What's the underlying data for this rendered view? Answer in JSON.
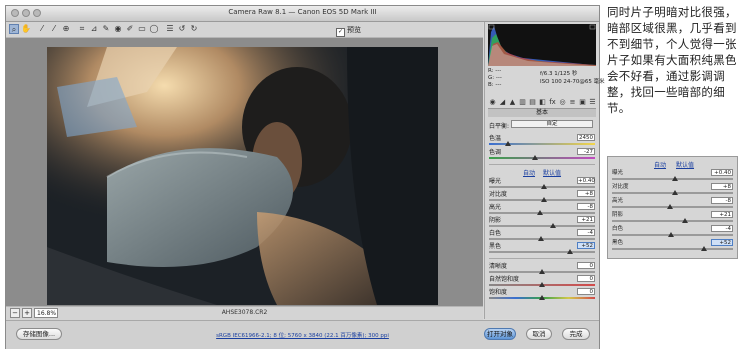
{
  "window": {
    "title": "Camera Raw 8.1  —  Canon EOS 5D Mark III"
  },
  "toolbar": {
    "tools": [
      "zoom-tool-icon",
      "hand-tool-icon",
      "white-balance-tool-icon",
      "color-sampler-tool-icon",
      "targeted-adjustment-tool-icon",
      "crop-tool-icon",
      "straighten-tool-icon",
      "spot-removal-tool-icon",
      "red-eye-removal-tool-icon",
      "adjustment-brush-icon",
      "graduated-filter-icon",
      "radial-filter-icon",
      "preferences-icon",
      "rotate-ccw-icon",
      "rotate-cw-icon"
    ],
    "preview_label": "预览",
    "preview_checked": true
  },
  "status": {
    "zoom_value": "16.8%",
    "filename": "AHSE3078.CR2"
  },
  "bottom": {
    "save_label": "存储图像...",
    "workflow_link": "sRGB IEC61966-2.1; 8 位; 5760 x 3840 (22.1 百万像素); 300 ppi",
    "open_label": "打开对象",
    "cancel_label": "取消",
    "done_label": "完成"
  },
  "camera_info": {
    "r_label": "R:",
    "g_label": "G:",
    "b_label": "B:",
    "r_value": "---",
    "g_value": "---",
    "b_value": "---",
    "aperture_shutter": "f/6.3   1/125 秒",
    "iso_lens": "ISO 100   24-70@65 毫米"
  },
  "panel": {
    "section_title": "基本",
    "white_balance_label": "白平衡:",
    "white_balance_value": "自定",
    "temperature_label": "色温",
    "temperature_value": "2450",
    "tint_label": "色调",
    "tint_value": "-27",
    "auto_label": "自动",
    "default_label": "默认值",
    "exposure_label": "曝光",
    "exposure_value": "+0.40",
    "contrast_label": "对比度",
    "contrast_value": "+8",
    "highlights_label": "高光",
    "highlights_value": "-8",
    "shadows_label": "阴影",
    "shadows_value": "+21",
    "whites_label": "白色",
    "whites_value": "-4",
    "blacks_label": "黑色",
    "blacks_value": "+52",
    "clarity_label": "清晰度",
    "clarity_value": "0",
    "vibrance_label": "自然饱和度",
    "vibrance_value": "0",
    "saturation_label": "饱和度",
    "saturation_value": "0"
  },
  "article": {
    "text": "同时片子明暗对比很强，暗部区域很黑，几乎看到不到细节，个人觉得一张片子如果有大面积纯黑色会不好看，通过影调调整，找回一些暗部的细节。"
  },
  "zoom_panel": {
    "auto_label": "自动",
    "default_label": "默认值",
    "exposure_label": "曝光",
    "exposure_value": "+0.40",
    "contrast_label": "对比度",
    "contrast_value": "+8",
    "highlights_label": "高光",
    "highlights_value": "-8",
    "shadows_label": "阴影",
    "shadows_value": "+21",
    "whites_label": "白色",
    "whites_value": "-4",
    "blacks_label": "黑色",
    "blacks_value": "+52"
  },
  "slider_levels": {
    "temperature": 0.18,
    "tint": 0.43,
    "exposure": 0.52,
    "contrast": 0.52,
    "highlights": 0.48,
    "shadows": 0.6,
    "whites": 0.49,
    "blacks": 0.76,
    "clarity": 0.5,
    "vibrance": 0.5,
    "saturation": 0.5
  },
  "colors": {
    "accent": "#4f7fc4",
    "link": "#1a3fa0"
  }
}
